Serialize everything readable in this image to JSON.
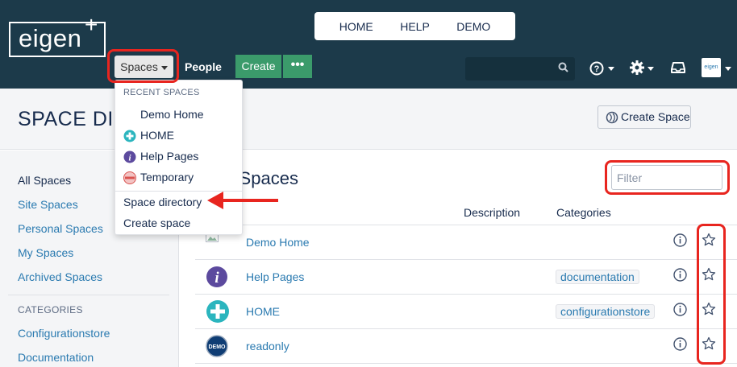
{
  "topbar": {
    "logo": "eigen",
    "logo_plus": "+",
    "tabs": [
      {
        "label": "HOME"
      },
      {
        "label": "HELP"
      },
      {
        "label": "DEMO"
      }
    ],
    "spaces_label": "Spaces",
    "people_label": "People",
    "create_label": "Create",
    "more_label": "•••",
    "search_placeholder": "",
    "avatar_text": "eigen"
  },
  "header": {
    "title": "SPACE DIRECTORY",
    "create_space_label": "Create Space"
  },
  "dropdown": {
    "heading": "RECENT SPACES",
    "recent": [
      {
        "label": "Demo Home",
        "icon": "none"
      },
      {
        "label": "HOME",
        "icon": "plus-circle-icon"
      },
      {
        "label": "Help Pages",
        "icon": "info-icon"
      },
      {
        "label": "Temporary",
        "icon": "temporary-badge-icon"
      }
    ],
    "space_directory": "Space directory",
    "create_space": "Create space"
  },
  "sidebar": {
    "items": [
      {
        "label": "All Spaces"
      },
      {
        "label": "Site Spaces"
      },
      {
        "label": "Personal Spaces"
      },
      {
        "label": "My Spaces"
      },
      {
        "label": "Archived Spaces"
      }
    ],
    "categories_heading": "CATEGORIES",
    "categories": [
      {
        "label": "Configurationstore"
      },
      {
        "label": "Documentation"
      }
    ]
  },
  "main": {
    "title": "All Spaces",
    "filter_placeholder": "Filter",
    "columns": {
      "description": "Description",
      "categories": "Categories"
    },
    "rows": [
      {
        "name": "Demo Home",
        "category": ""
      },
      {
        "name": "Help Pages",
        "category": "documentation"
      },
      {
        "name": "HOME",
        "category": "configurationstore"
      },
      {
        "name": "readonly",
        "category": ""
      }
    ],
    "demo_badge_text": "DEMO"
  },
  "colors": {
    "navbar": "#1c3a4a",
    "link": "#2a7ab0",
    "create_button": "#3b9b6b",
    "annotation": "#e8251f"
  }
}
